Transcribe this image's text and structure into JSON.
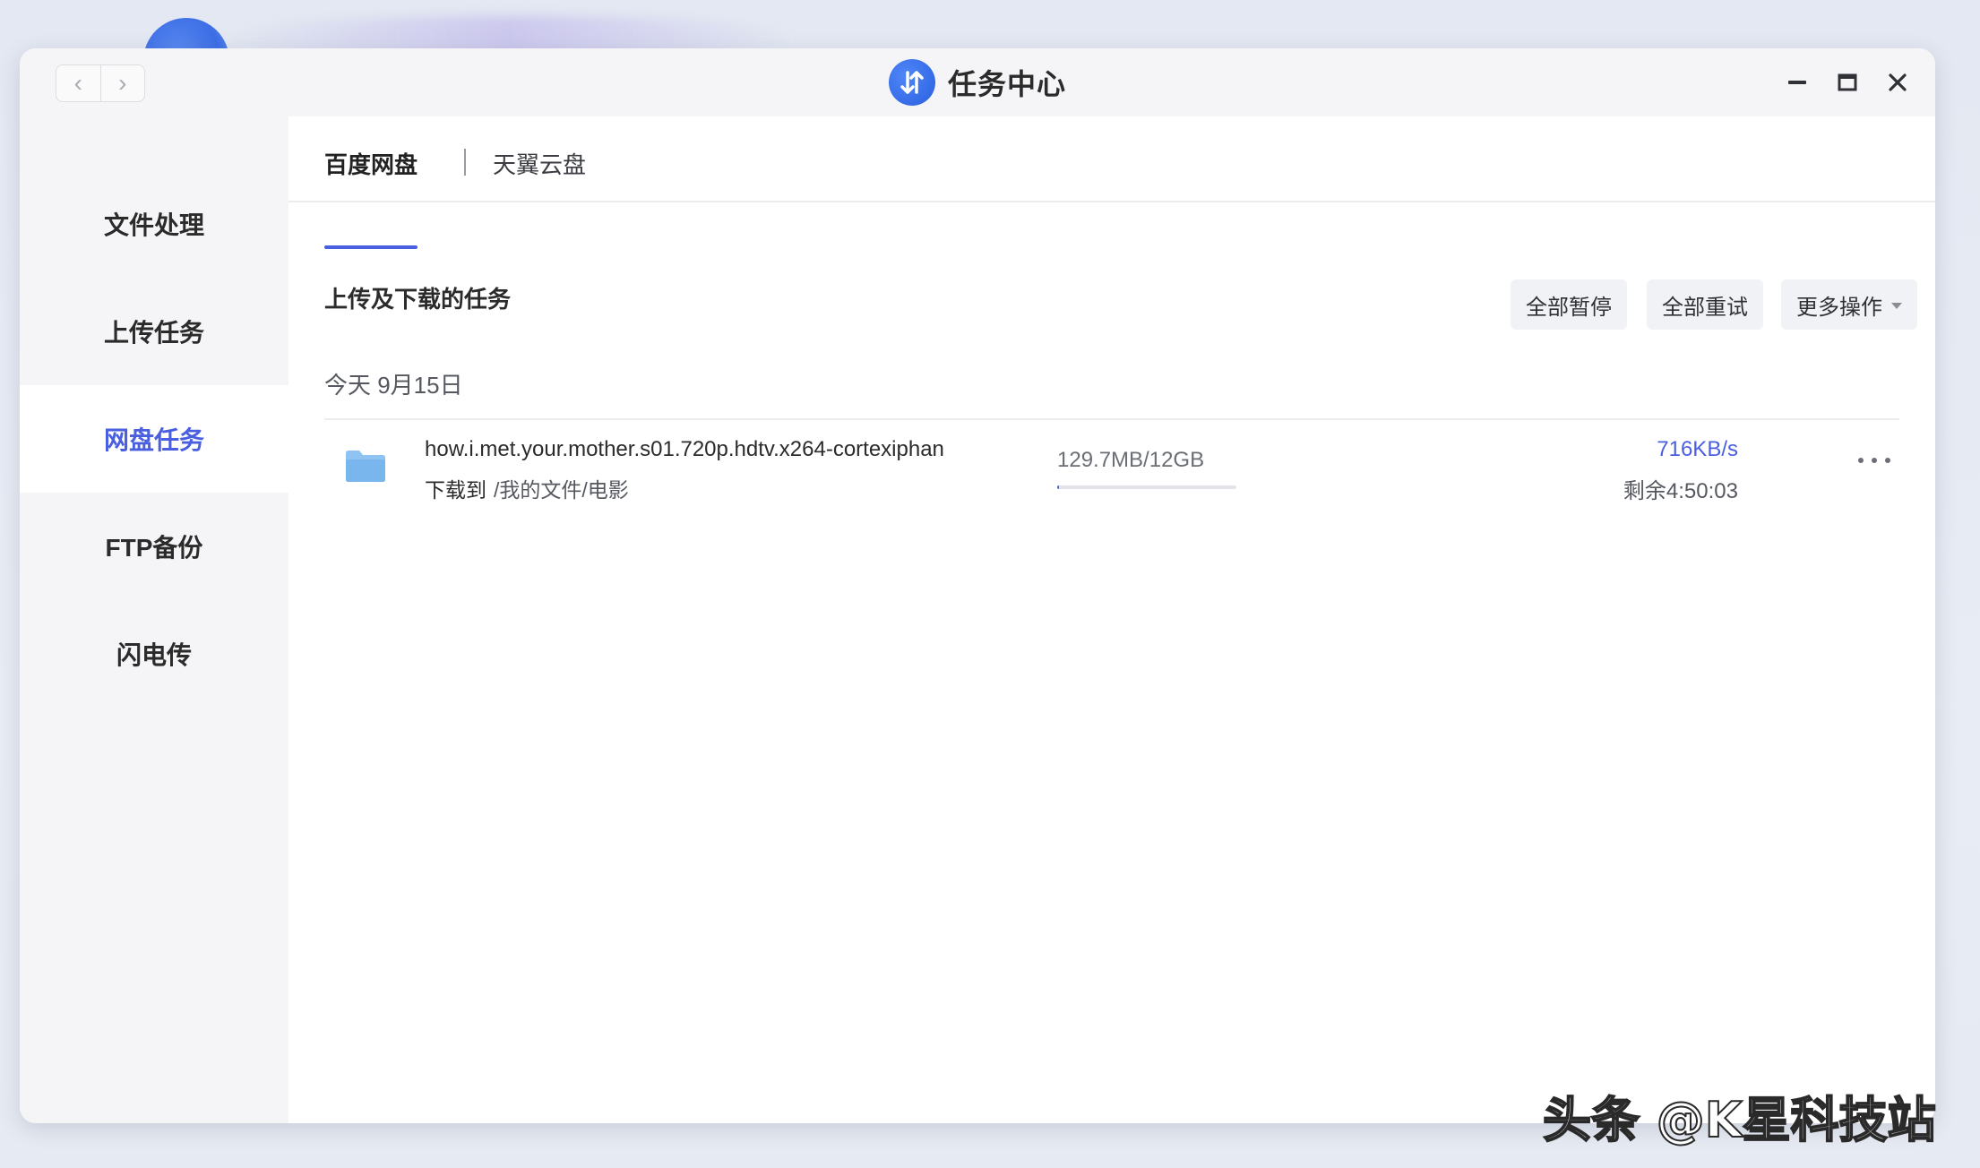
{
  "window": {
    "title": "任务中心",
    "nav_back": "‹",
    "nav_forward": "›"
  },
  "sidebar": {
    "items": [
      {
        "label": "文件处理",
        "active": false
      },
      {
        "label": "上传任务",
        "active": false
      },
      {
        "label": "网盘任务",
        "active": true
      },
      {
        "label": "FTP备份",
        "active": false
      },
      {
        "label": "闪电传",
        "active": false
      }
    ]
  },
  "tabs": [
    {
      "label": "百度网盘",
      "active": true
    },
    {
      "label": "天翼云盘",
      "active": false
    }
  ],
  "section": {
    "title": "上传及下载的任务",
    "pause_all": "全部暂停",
    "retry_all": "全部重试",
    "more_actions": "更多操作"
  },
  "date_group": "今天 9月15日",
  "tasks": [
    {
      "name": "how.i.met.your.mother.s01.720p.hdtv.x264-cortexiphan",
      "dest_label": "下载到",
      "dest_path": "/我的文件/电影",
      "size": "129.7MB/12GB",
      "progress": 0.011,
      "speed": "716KB/s",
      "remaining": "剩余4:50:03"
    }
  ],
  "watermark": "头条 @K星科技站",
  "colors": {
    "accent": "#4a5fe0",
    "sidebar_bg": "#f5f5f7",
    "folder": "#7fb8f0"
  }
}
